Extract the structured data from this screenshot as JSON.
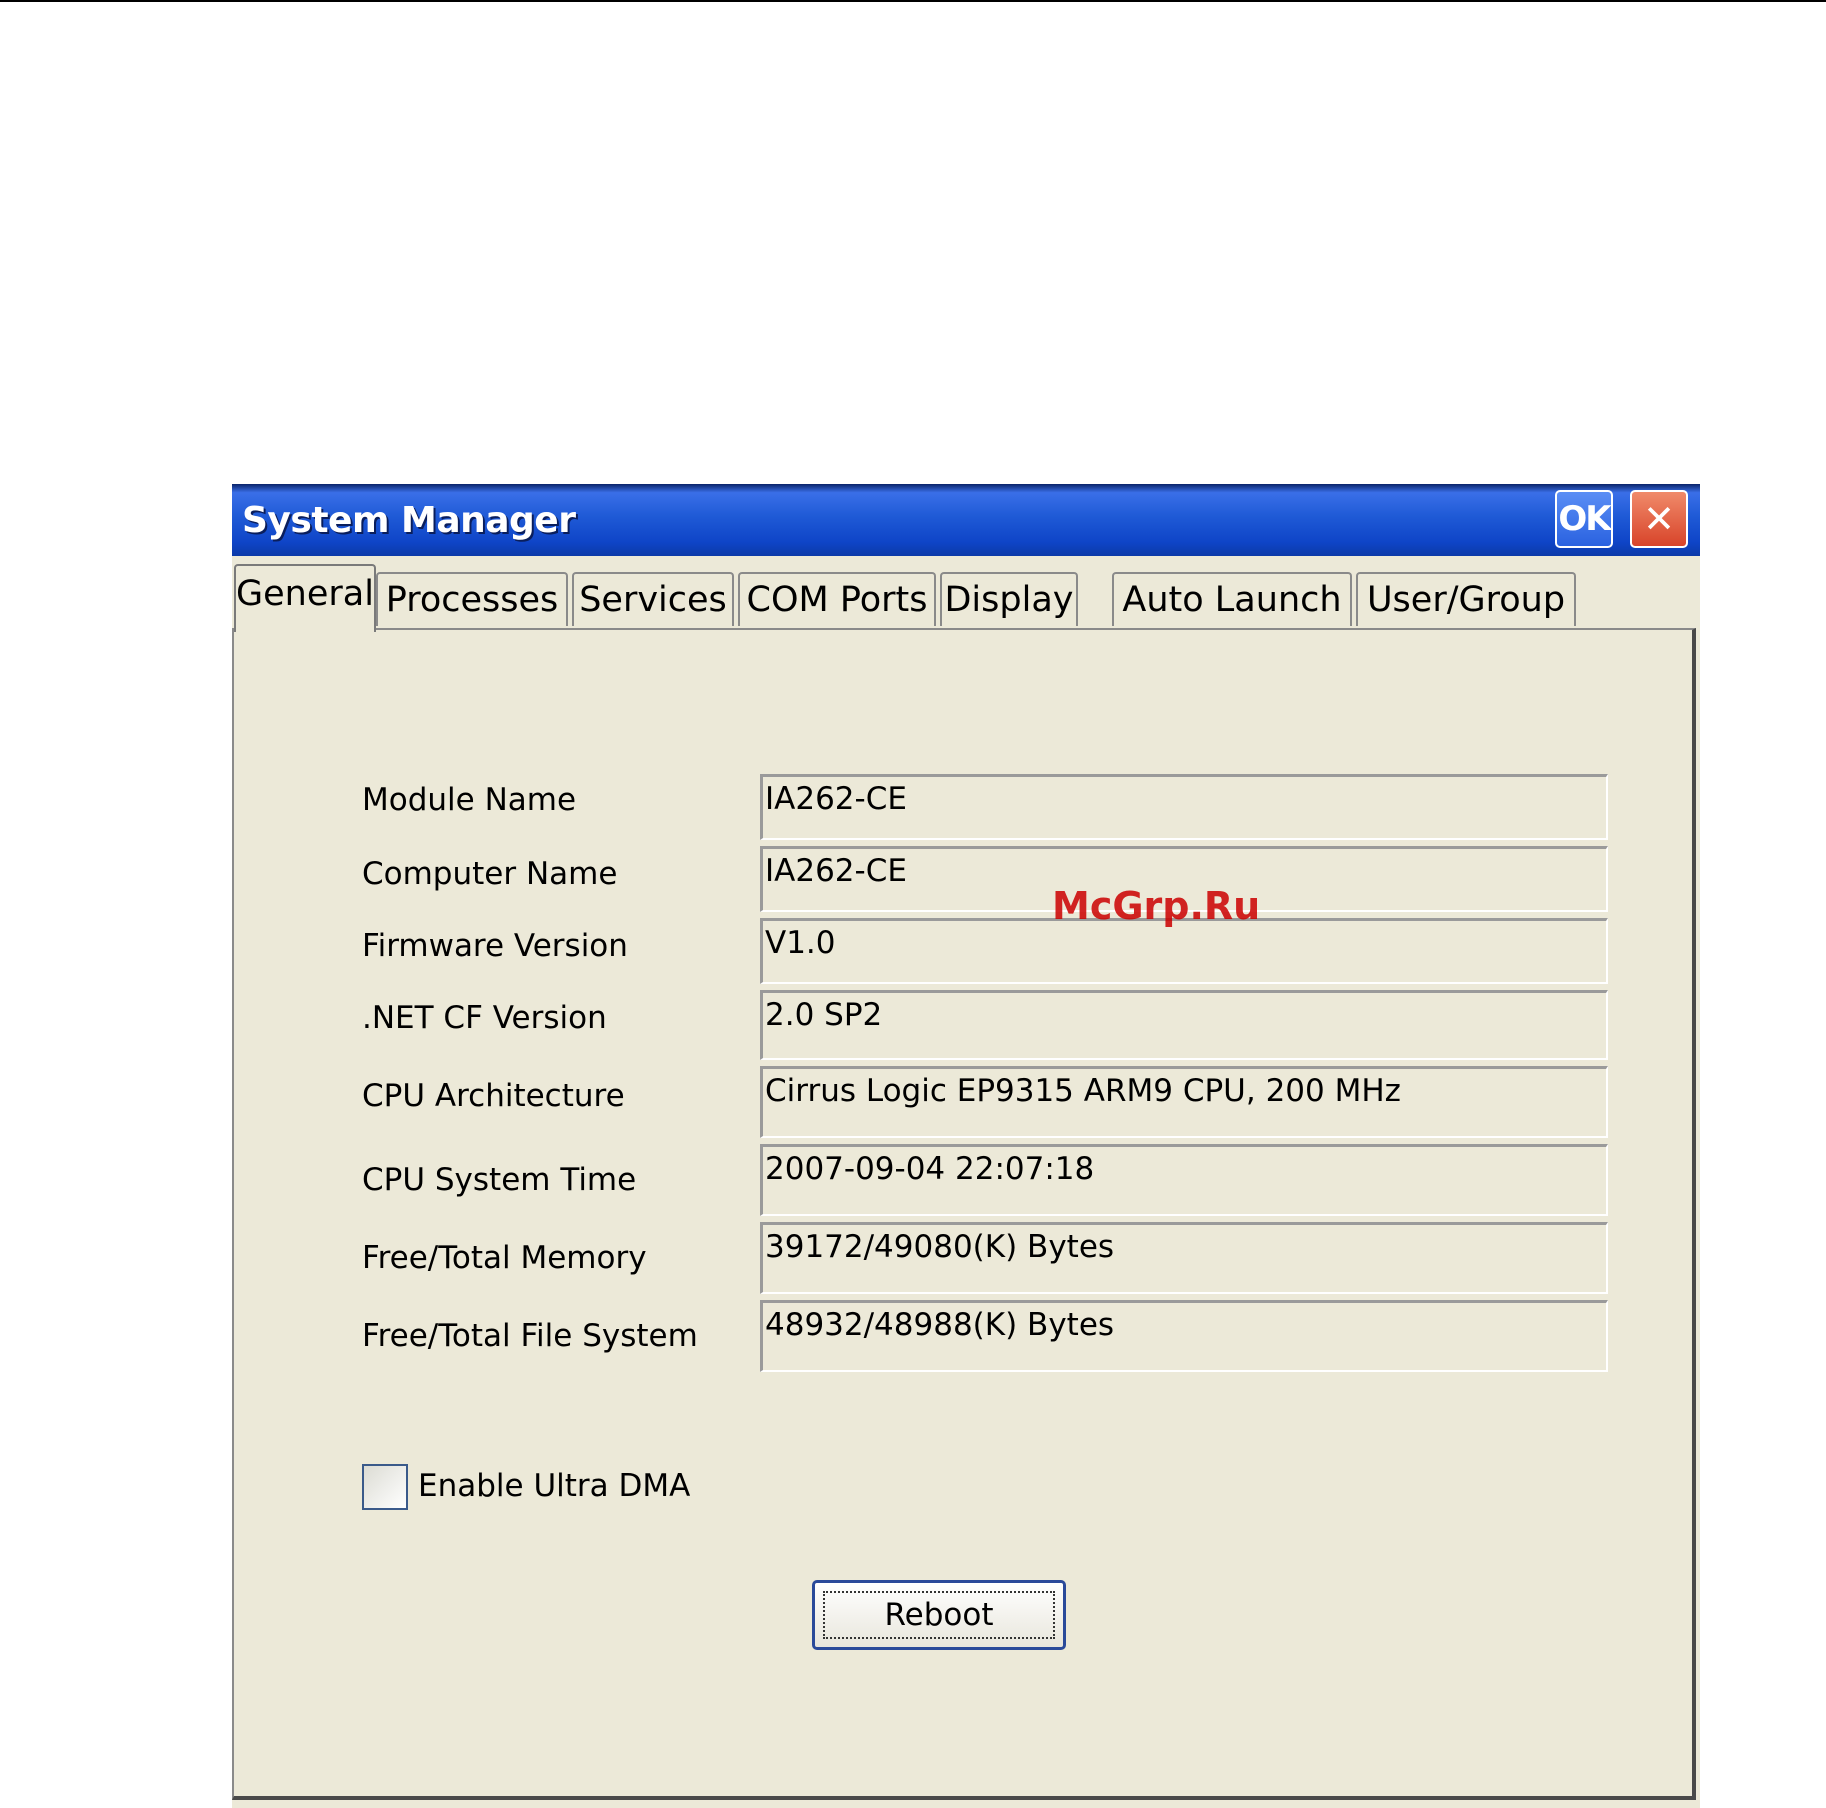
{
  "window": {
    "title": "System Manager",
    "ok_label": "OK",
    "close_label": "✕"
  },
  "tabs": [
    {
      "label": "General",
      "active": true
    },
    {
      "label": "Processes"
    },
    {
      "label": "Services"
    },
    {
      "label": "COM Ports"
    },
    {
      "label": "Display"
    },
    {
      "label": "Auto Launch"
    },
    {
      "label": "User/Group"
    }
  ],
  "general": {
    "rows": [
      {
        "label": "Module Name",
        "value": "IA262-CE"
      },
      {
        "label": "Computer Name",
        "value": "IA262-CE"
      },
      {
        "label": "Firmware Version",
        "value": "V1.0"
      },
      {
        "label": ".NET CF Version",
        "value": "2.0 SP2"
      },
      {
        "label": "CPU Architecture",
        "value": "Cirrus Logic EP9315 ARM9 CPU, 200 MHz"
      },
      {
        "label": "CPU System Time",
        "value": "2007-09-04 22:07:18"
      },
      {
        "label": "Free/Total Memory",
        "value": "39172/49080(K) Bytes"
      },
      {
        "label": "Free/Total File System",
        "value": "48932/48988(K) Bytes"
      }
    ],
    "ultra_dma_label": "Enable Ultra DMA",
    "ultra_dma_checked": false,
    "reboot_label": "Reboot"
  },
  "watermark": "McGrp.Ru"
}
